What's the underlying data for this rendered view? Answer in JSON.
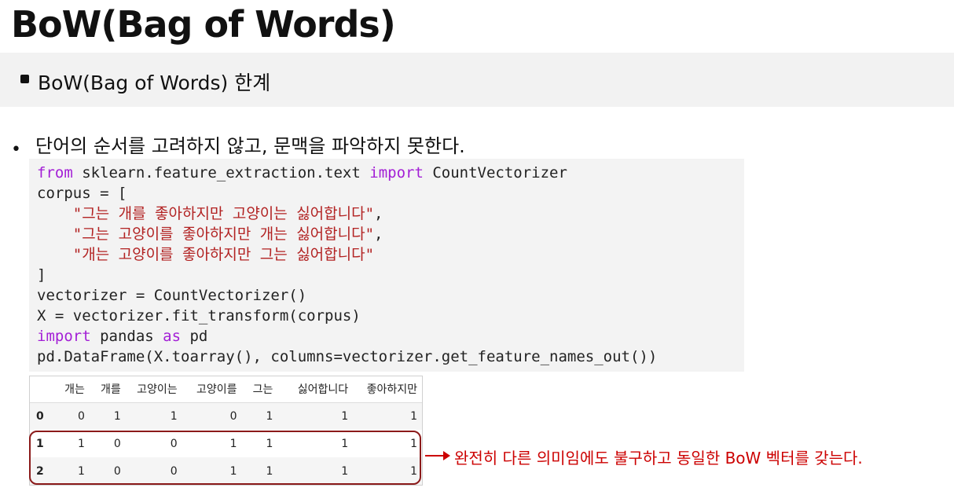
{
  "slide": {
    "title": "BoW(Bag of Words)",
    "section_heading": "BoW(Bag of Words) 한계",
    "point": "단어의 순서를 고려하지 않고, 문맥을 파악하지 못한다.",
    "bullet_glyph": "•",
    "note": "완전히 다른 의미임에도 불구하고 동일한 BoW 벡터를 갖는다."
  },
  "code": {
    "lines": [
      [
        {
          "t": "kw",
          "v": "from"
        },
        {
          "t": "plain",
          "v": " sklearn.feature_extraction.text "
        },
        {
          "t": "kw",
          "v": "import"
        },
        {
          "t": "plain",
          "v": " CountVectorizer"
        }
      ],
      [
        {
          "t": "plain",
          "v": "corpus = ["
        }
      ],
      [
        {
          "t": "plain",
          "v": "    "
        },
        {
          "t": "str",
          "v": "\"그는 개를 좋아하지만 고양이는 싫어합니다\""
        },
        {
          "t": "plain",
          "v": ","
        }
      ],
      [
        {
          "t": "plain",
          "v": "    "
        },
        {
          "t": "str",
          "v": "\"그는 고양이를 좋아하지만 개는 싫어합니다\""
        },
        {
          "t": "plain",
          "v": ","
        }
      ],
      [
        {
          "t": "plain",
          "v": "    "
        },
        {
          "t": "str",
          "v": "\"개는 고양이를 좋아하지만 그는 싫어합니다\""
        }
      ],
      [
        {
          "t": "plain",
          "v": "]"
        }
      ],
      [
        {
          "t": "plain",
          "v": "vectorizer = CountVectorizer()"
        }
      ],
      [
        {
          "t": "plain",
          "v": "X = vectorizer.fit_transform(corpus)"
        }
      ],
      [
        {
          "t": "kw",
          "v": "import"
        },
        {
          "t": "plain",
          "v": " pandas "
        },
        {
          "t": "kw",
          "v": "as"
        },
        {
          "t": "plain",
          "v": " pd"
        }
      ],
      [
        {
          "t": "plain",
          "v": "pd.DataFrame(X.toarray(), columns=vectorizer.get_feature_names_out())"
        }
      ]
    ]
  },
  "table": {
    "columns": [
      "",
      "개는",
      "개를",
      "고양이는",
      "고양이를",
      "그는",
      "싫어합니다",
      "좋아하지만"
    ],
    "rows": [
      [
        "0",
        "0",
        "1",
        "1",
        "0",
        "1",
        "1",
        "1"
      ],
      [
        "1",
        "1",
        "0",
        "0",
        "1",
        "1",
        "1",
        "1"
      ],
      [
        "2",
        "1",
        "0",
        "0",
        "1",
        "1",
        "1",
        "1"
      ]
    ]
  },
  "colors": {
    "keyword": "#a31fd6",
    "string": "#b22222",
    "annotation": "#cc0000",
    "highlight_border": "#8b1a1a"
  }
}
